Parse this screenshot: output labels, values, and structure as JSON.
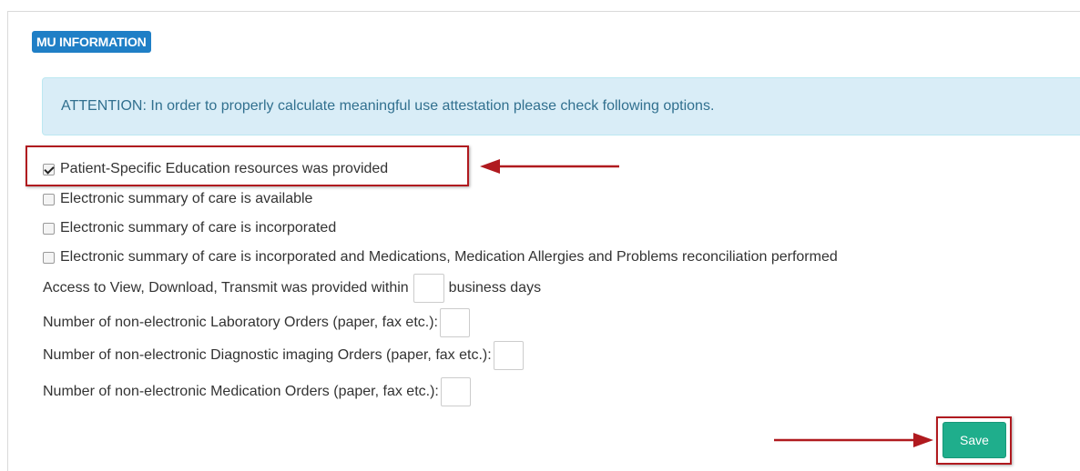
{
  "section": {
    "title": "MU INFORMATION"
  },
  "alert": {
    "text": "ATTENTION: In order to properly calculate meaningful use attestation please check following options."
  },
  "checkboxes": [
    {
      "label": "Patient-Specific Education resources was provided",
      "checked": true
    },
    {
      "label": "Electronic summary of care is available",
      "checked": false
    },
    {
      "label": "Electronic summary of care is incorporated",
      "checked": false
    },
    {
      "label": "Electronic summary of care is incorporated and Medications, Medication Allergies and Problems reconciliation performed",
      "checked": false
    }
  ],
  "access_row": {
    "prefix": "Access to View, Download, Transmit was provided within",
    "suffix": "business days",
    "value": ""
  },
  "order_fields": [
    {
      "label": "Number of non-electronic Laboratory Orders (paper, fax etc.):",
      "value": ""
    },
    {
      "label": "Number of non-electronic Diagnostic imaging Orders (paper, fax etc.):",
      "value": ""
    },
    {
      "label": "Number of non-electronic Medication Orders (paper, fax etc.):",
      "value": ""
    }
  ],
  "actions": {
    "save_label": "Save"
  },
  "colors": {
    "badge": "#1f7fc6",
    "alert_bg": "#d9edf7",
    "alert_text": "#31708f",
    "save": "#1fae8c",
    "annotation": "#b01a1f"
  },
  "annotations": {
    "arrow_icon": "arrow-left-icon",
    "arrow_save_icon": "arrow-right-icon"
  }
}
